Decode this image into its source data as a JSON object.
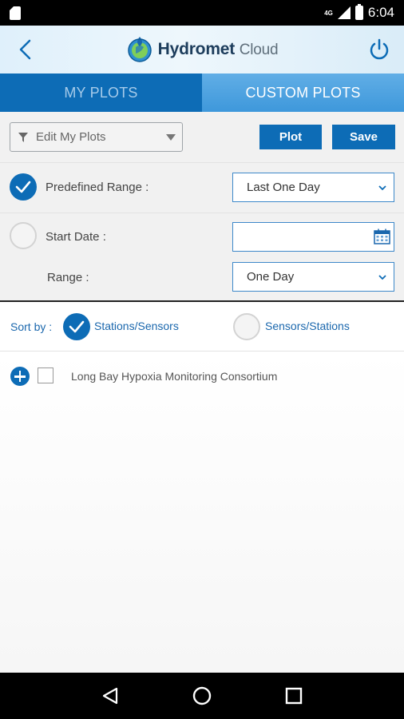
{
  "status_bar": {
    "time": "6:04",
    "network_type": "4G",
    "icons": [
      "sd-card-icon",
      "signal-icon",
      "battery-icon"
    ]
  },
  "header": {
    "brand_name": "Hydromet",
    "brand_suffix": "Cloud",
    "icons": [
      "back-arrow-icon",
      "hydromet-logo",
      "power-icon"
    ]
  },
  "tabs": [
    {
      "label": "MY PLOTS",
      "selected": false
    },
    {
      "label": "CUSTOM PLOTS",
      "selected": true
    }
  ],
  "controls": {
    "plot_dropdown": {
      "value": "Edit My Plots",
      "icon": "filter-icon"
    },
    "plot_button": "Plot",
    "save_button": "Save",
    "predefined_range": {
      "label": "Predefined Range :",
      "selected": true,
      "value": "Last One Day"
    },
    "start_date": {
      "label": "Start Date :",
      "selected": false,
      "value": ""
    },
    "range": {
      "label": "Range :",
      "value": "One Day"
    }
  },
  "sort": {
    "label": "Sort by :",
    "options": [
      {
        "label": "Stations/Sensors",
        "selected": true
      },
      {
        "label": "Sensors/Stations",
        "selected": false
      }
    ]
  },
  "tree": {
    "items": [
      {
        "label": "Long Bay Hypoxia Monitoring Consortium",
        "checked": false,
        "expanded": false
      }
    ]
  },
  "nav": {
    "icons": [
      "back-triangle-icon",
      "home-circle-icon",
      "recents-square-icon"
    ]
  },
  "colors": {
    "primary": "#0d6cb6",
    "tab_active": "#4a9fe0",
    "link_text": "#1a67ad"
  }
}
